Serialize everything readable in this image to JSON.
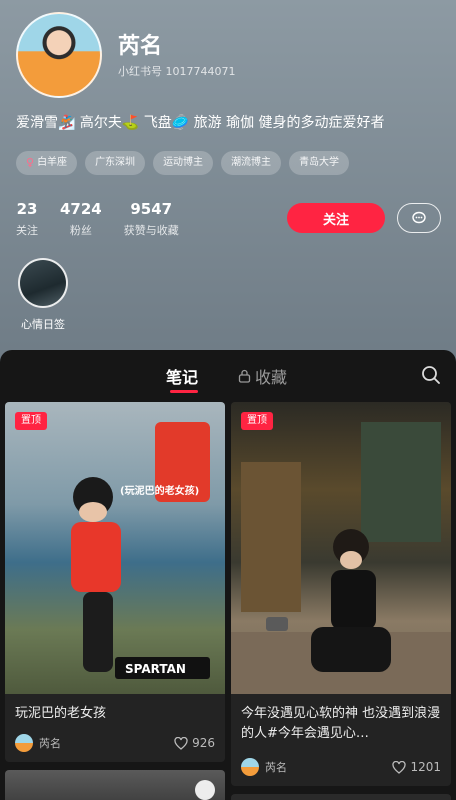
{
  "profile": {
    "name": "芮名",
    "redbook_id": "小红书号 1017744071",
    "bio": "爱滑雪🏂 高尔夫⛳ 飞盘🥏 旅游 瑜伽 健身的多动症爱好者",
    "tags": [
      "白羊座",
      "广东深圳",
      "运动博主",
      "潮流博主",
      "青岛大学"
    ],
    "stats": [
      {
        "value": "23",
        "label": "关注"
      },
      {
        "value": "4724",
        "label": "粉丝"
      },
      {
        "value": "9547",
        "label": "获赞与收藏"
      }
    ],
    "follow_label": "关注",
    "mood_label": "心情日签"
  },
  "tabs": {
    "notes": "笔记",
    "favorites": "收藏"
  },
  "cards": [
    {
      "badge": "置顶",
      "title": "玩泥巴的老女孩",
      "author": "芮名",
      "likes": "926"
    },
    {
      "badge": "置顶",
      "title": "今年没遇见心软的神 也没遇到浪漫的人#今年会遇见心…",
      "author": "芮名",
      "likes": "1201"
    }
  ],
  "colors": {
    "accent": "#ff2442"
  }
}
